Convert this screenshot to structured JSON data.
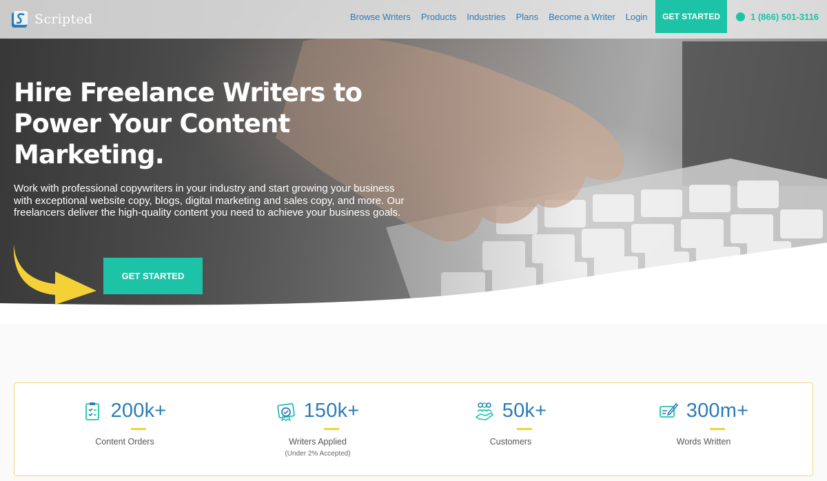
{
  "brand": {
    "name": "Scripted",
    "accent": "#1cc3a7",
    "link_color": "#2b7bb9",
    "highlight": "#f4d237"
  },
  "nav": {
    "links": [
      "Browse Writers",
      "Products",
      "Industries",
      "Plans",
      "Become a Writer",
      "Login"
    ],
    "cta_label": "GET STARTED",
    "phone": "1 (866) 501-3116",
    "phone_icon": "phone-icon"
  },
  "hero": {
    "title": "Hire Freelance Writers to Power Your Content Marketing.",
    "description": "Work with professional copywriters in your industry and start growing your business with exceptional website copy, blogs, digital marketing and sales copy, and more. Our freelancers deliver the high-quality content you need to achieve your business goals.",
    "cta_label": "GET STARTED"
  },
  "stats": [
    {
      "icon": "clipboard-checklist-icon",
      "value": "200k+",
      "label": "Content Orders",
      "sub": ""
    },
    {
      "icon": "writer-badge-icon",
      "value": "150k+",
      "label": "Writers Applied",
      "sub": "(Under 2% Accepted)"
    },
    {
      "icon": "customers-hand-icon",
      "value": "50k+",
      "label": "Customers",
      "sub": ""
    },
    {
      "icon": "pen-writing-icon",
      "value": "300m+",
      "label": "Words Written",
      "sub": ""
    }
  ]
}
